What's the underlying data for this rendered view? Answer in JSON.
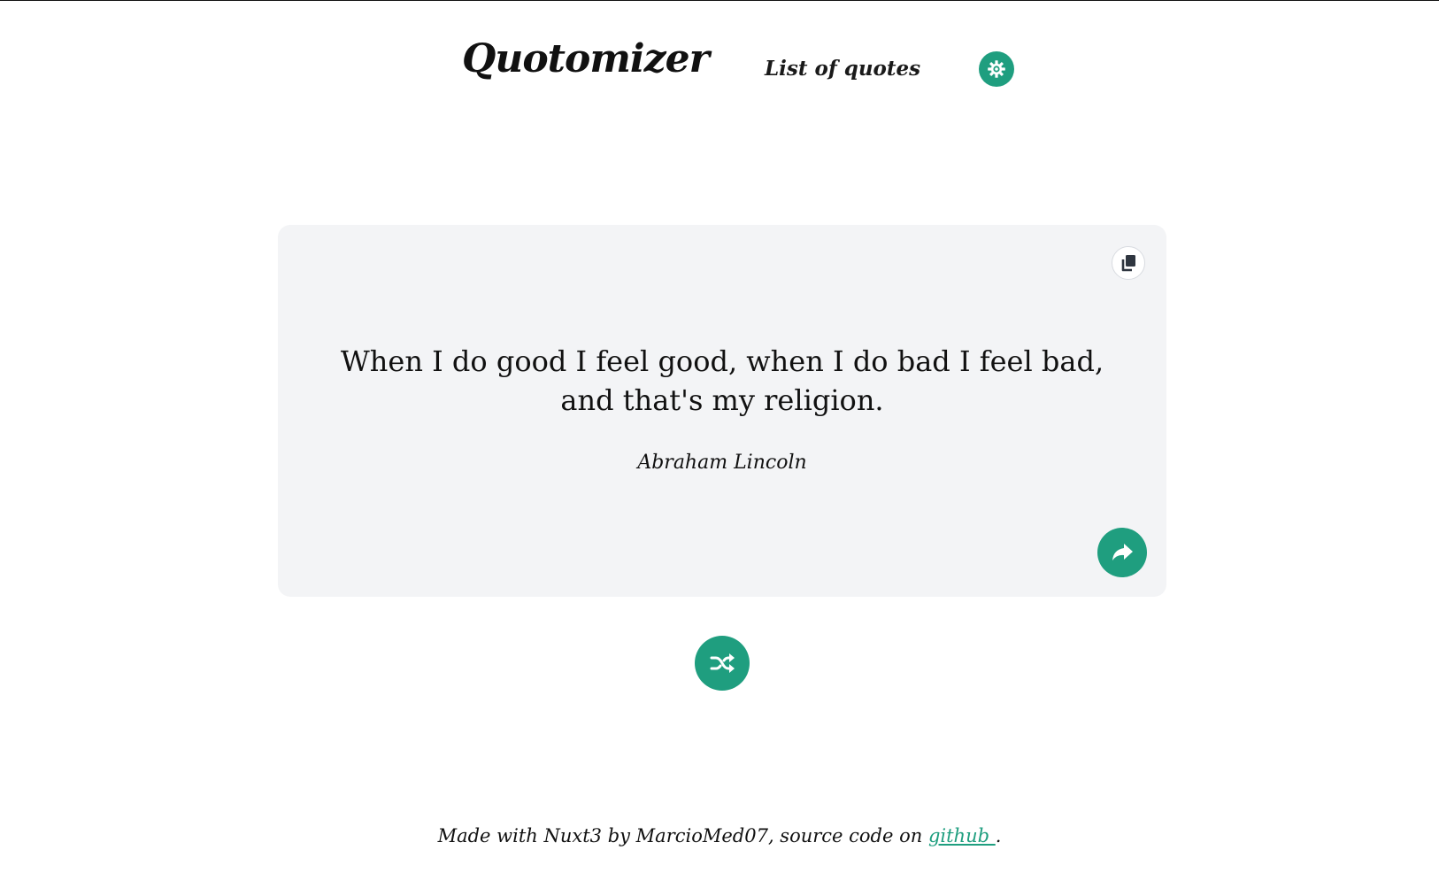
{
  "colors": {
    "accent": "#1f9e7f",
    "accent_dark": "#0f3d33",
    "card_bg": "#f3f4f6",
    "text": "#111111"
  },
  "header": {
    "logo_text": "Quotomizer",
    "nav_label": "List of quotes",
    "settings_icon": "gear-icon"
  },
  "quote": {
    "text": "When I do good I feel good, when I do bad I feel bad, and that's my religion.",
    "author": "Abraham Lincoln",
    "copy_icon": "copy-icon",
    "share_icon": "share-icon"
  },
  "actions": {
    "shuffle_icon": "shuffle-icon"
  },
  "footer": {
    "prefix": "Made with Nuxt3 by MarcioMed07, source code on ",
    "link_text": "github ",
    "suffix": "."
  }
}
